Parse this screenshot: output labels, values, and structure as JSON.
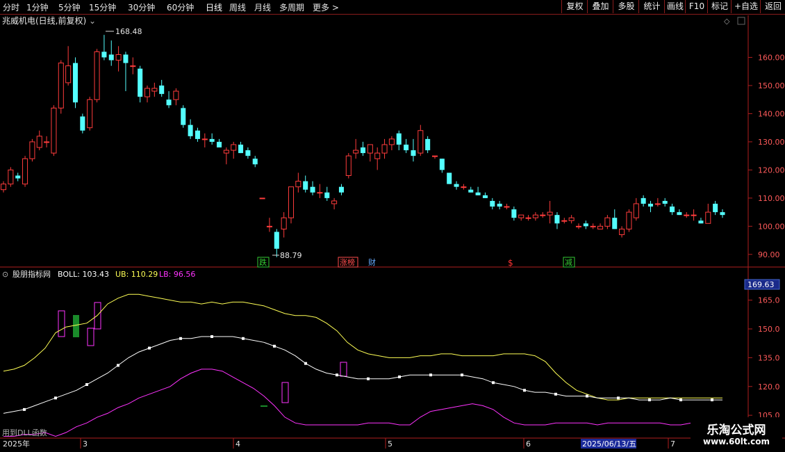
{
  "toolbar": {
    "timeframes": [
      "分时",
      "1分钟",
      "5分钟",
      "15分钟",
      "30分钟",
      "60分钟",
      "日线",
      "周线",
      "月线",
      "多周期",
      "更多 >"
    ],
    "active": "日线",
    "actions": [
      "复权",
      "叠加",
      "多股",
      "统计",
      "画线",
      "F10",
      "标记",
      "+自选",
      "返回"
    ]
  },
  "main_panel": {
    "title": "兆威机电(日线,前复权)",
    "high_label": "168.48",
    "low_label": "88.79",
    "event_markers": [
      {
        "text": "跌",
        "color": "#33cc33",
        "boxed": true
      },
      {
        "text": "涨榜",
        "color": "#ff4d4d",
        "boxed": true
      },
      {
        "text": "财",
        "color": "#66aaff",
        "boxed": false
      },
      {
        "text": "$",
        "color": "#ff3333",
        "boxed": false
      },
      {
        "text": "减",
        "color": "#33cc33",
        "boxed": true
      }
    ]
  },
  "indicator_panel": {
    "title": "股朋指标网",
    "boll_label": "BOLL: 103.43",
    "ub_label": "UB: 110.29",
    "lb_label": "LB: 96.56",
    "value_box": "169.63",
    "bottom_text": "用到DLL函数"
  },
  "date_axis": {
    "labels": [
      "2025年",
      "3",
      "4",
      "5",
      "6",
      "2025/06/13/五",
      "7"
    ]
  },
  "watermark": {
    "line1": "乐淘公式网",
    "line2": "www.60lt.com"
  },
  "colors": {
    "up": "#ff3c3c",
    "down": "#54ffff",
    "boll": "#ffffff",
    "ub": "#ffff55",
    "lb": "#ff33ff",
    "axis": "#b01e1e"
  },
  "chart_data": [
    {
      "type": "candlestick",
      "title": "兆威机电(日线,前复权)",
      "y_ticks": [
        90,
        100,
        110,
        120,
        130,
        140,
        150,
        160
      ],
      "ylim": [
        86,
        171
      ],
      "candles": [
        {
          "o": 113,
          "h": 116,
          "l": 112,
          "c": 115
        },
        {
          "o": 115,
          "h": 121,
          "l": 114,
          "c": 120
        },
        {
          "o": 118,
          "h": 119,
          "l": 116,
          "c": 117
        },
        {
          "o": 115,
          "h": 125,
          "l": 114,
          "c": 124
        },
        {
          "o": 124,
          "h": 131,
          "l": 123,
          "c": 130
        },
        {
          "o": 128,
          "h": 134,
          "l": 127,
          "c": 132
        },
        {
          "o": 130,
          "h": 132,
          "l": 128,
          "c": 130
        },
        {
          "o": 126,
          "h": 143,
          "l": 125,
          "c": 142
        },
        {
          "o": 142,
          "h": 159,
          "l": 140,
          "c": 158
        },
        {
          "o": 151,
          "h": 164,
          "l": 150,
          "c": 157
        },
        {
          "o": 158,
          "h": 160,
          "l": 142,
          "c": 144
        },
        {
          "o": 139,
          "h": 140,
          "l": 133,
          "c": 134
        },
        {
          "o": 135,
          "h": 146,
          "l": 134,
          "c": 145
        },
        {
          "o": 145,
          "h": 163,
          "l": 144,
          "c": 162
        },
        {
          "o": 162,
          "h": 168,
          "l": 159,
          "c": 160
        },
        {
          "o": 161,
          "h": 166,
          "l": 157,
          "c": 159
        },
        {
          "o": 159,
          "h": 164,
          "l": 155,
          "c": 161
        },
        {
          "o": 161,
          "h": 162,
          "l": 148,
          "c": 158
        },
        {
          "o": 157,
          "h": 160,
          "l": 154,
          "c": 157
        },
        {
          "o": 156,
          "h": 157,
          "l": 144,
          "c": 146
        },
        {
          "o": 146,
          "h": 150,
          "l": 144,
          "c": 149
        },
        {
          "o": 148,
          "h": 151,
          "l": 146,
          "c": 149
        },
        {
          "o": 150,
          "h": 152,
          "l": 146,
          "c": 147
        },
        {
          "o": 145,
          "h": 148,
          "l": 142,
          "c": 143
        },
        {
          "o": 145,
          "h": 149,
          "l": 143,
          "c": 148
        },
        {
          "o": 142,
          "h": 143,
          "l": 135,
          "c": 136
        },
        {
          "o": 136,
          "h": 138,
          "l": 131,
          "c": 132
        },
        {
          "o": 134,
          "h": 135,
          "l": 130,
          "c": 131
        },
        {
          "o": 131,
          "h": 133,
          "l": 128,
          "c": 131
        },
        {
          "o": 131,
          "h": 133,
          "l": 129,
          "c": 130
        },
        {
          "o": 130,
          "h": 131,
          "l": 128,
          "c": 128
        },
        {
          "o": 126,
          "h": 128,
          "l": 122,
          "c": 127
        },
        {
          "o": 127,
          "h": 130,
          "l": 124,
          "c": 129
        },
        {
          "o": 129,
          "h": 130,
          "l": 126,
          "c": 126
        },
        {
          "o": 127,
          "h": 128,
          "l": 124,
          "c": 125
        },
        {
          "o": 124,
          "h": 125,
          "l": 121,
          "c": 122
        },
        {
          "o": 110,
          "h": 110,
          "l": 110,
          "c": 110
        },
        {
          "o": 100,
          "h": 103,
          "l": 98,
          "c": 100
        },
        {
          "o": 98,
          "h": 99,
          "l": 89,
          "c": 92
        },
        {
          "o": 99,
          "h": 105,
          "l": 96,
          "c": 103
        },
        {
          "o": 103,
          "h": 114,
          "l": 101,
          "c": 114
        },
        {
          "o": 114,
          "h": 119,
          "l": 112,
          "c": 116
        },
        {
          "o": 116,
          "h": 118,
          "l": 112,
          "c": 113
        },
        {
          "o": 114,
          "h": 116,
          "l": 111,
          "c": 112
        },
        {
          "o": 112,
          "h": 115,
          "l": 110,
          "c": 112
        },
        {
          "o": 112,
          "h": 114,
          "l": 109,
          "c": 110
        },
        {
          "o": 108,
          "h": 110,
          "l": 106,
          "c": 109
        },
        {
          "o": 114,
          "h": 115,
          "l": 111,
          "c": 112
        },
        {
          "o": 118,
          "h": 126,
          "l": 117,
          "c": 125
        },
        {
          "o": 126,
          "h": 131,
          "l": 124,
          "c": 127
        },
        {
          "o": 128,
          "h": 130,
          "l": 125,
          "c": 126
        },
        {
          "o": 126,
          "h": 129,
          "l": 123,
          "c": 129
        },
        {
          "o": 124,
          "h": 128,
          "l": 120,
          "c": 126
        },
        {
          "o": 126,
          "h": 131,
          "l": 124,
          "c": 129
        },
        {
          "o": 129,
          "h": 132,
          "l": 127,
          "c": 131
        },
        {
          "o": 133,
          "h": 134,
          "l": 127,
          "c": 129
        },
        {
          "o": 129,
          "h": 131,
          "l": 126,
          "c": 127
        },
        {
          "o": 127,
          "h": 131,
          "l": 123,
          "c": 125
        },
        {
          "o": 126,
          "h": 136,
          "l": 125,
          "c": 134
        },
        {
          "o": 131,
          "h": 132,
          "l": 126,
          "c": 127
        },
        {
          "o": 125,
          "h": 125,
          "l": 124,
          "c": 125
        },
        {
          "o": 124,
          "h": 124,
          "l": 119,
          "c": 120
        },
        {
          "o": 119,
          "h": 119,
          "l": 115,
          "c": 115
        },
        {
          "o": 115,
          "h": 116,
          "l": 113,
          "c": 114
        },
        {
          "o": 114,
          "h": 115,
          "l": 113,
          "c": 114
        },
        {
          "o": 113,
          "h": 114,
          "l": 112,
          "c": 112
        },
        {
          "o": 112,
          "h": 114,
          "l": 111,
          "c": 111
        },
        {
          "o": 111,
          "h": 112,
          "l": 110,
          "c": 110
        },
        {
          "o": 109,
          "h": 110,
          "l": 106,
          "c": 107
        },
        {
          "o": 108,
          "h": 109,
          "l": 106,
          "c": 107
        },
        {
          "o": 107,
          "h": 108,
          "l": 106,
          "c": 107
        },
        {
          "o": 106,
          "h": 107,
          "l": 102,
          "c": 103
        },
        {
          "o": 103,
          "h": 104,
          "l": 102,
          "c": 104
        },
        {
          "o": 103,
          "h": 104,
          "l": 102,
          "c": 103
        },
        {
          "o": 103,
          "h": 105,
          "l": 102,
          "c": 104
        },
        {
          "o": 104,
          "h": 105,
          "l": 103,
          "c": 104
        },
        {
          "o": 104,
          "h": 109,
          "l": 101,
          "c": 105
        },
        {
          "o": 104,
          "h": 105,
          "l": 99,
          "c": 101
        },
        {
          "o": 102,
          "h": 103,
          "l": 101,
          "c": 102
        },
        {
          "o": 102,
          "h": 104,
          "l": 101,
          "c": 103
        },
        {
          "o": 100,
          "h": 101,
          "l": 99,
          "c": 100
        },
        {
          "o": 101,
          "h": 102,
          "l": 99,
          "c": 100
        },
        {
          "o": 100,
          "h": 101,
          "l": 99,
          "c": 100
        },
        {
          "o": 99,
          "h": 101,
          "l": 99,
          "c": 100
        },
        {
          "o": 100,
          "h": 104,
          "l": 99,
          "c": 103
        },
        {
          "o": 103,
          "h": 106,
          "l": 99,
          "c": 99
        },
        {
          "o": 97,
          "h": 100,
          "l": 96,
          "c": 99
        },
        {
          "o": 99,
          "h": 106,
          "l": 98,
          "c": 105
        },
        {
          "o": 103,
          "h": 110,
          "l": 102,
          "c": 108
        },
        {
          "o": 110,
          "h": 111,
          "l": 107,
          "c": 108
        },
        {
          "o": 108,
          "h": 109,
          "l": 105,
          "c": 107
        },
        {
          "o": 108,
          "h": 110,
          "l": 107,
          "c": 108
        },
        {
          "o": 109,
          "h": 110,
          "l": 107,
          "c": 108
        },
        {
          "o": 107,
          "h": 108,
          "l": 104,
          "c": 105
        },
        {
          "o": 105,
          "h": 106,
          "l": 104,
          "c": 104
        },
        {
          "o": 104,
          "h": 105,
          "l": 103,
          "c": 104
        },
        {
          "o": 104,
          "h": 106,
          "l": 102,
          "c": 104
        },
        {
          "o": 102,
          "h": 103,
          "l": 101,
          "c": 101
        },
        {
          "o": 101,
          "h": 108,
          "l": 101,
          "c": 105
        },
        {
          "o": 108,
          "h": 109,
          "l": 104,
          "c": 105
        },
        {
          "o": 105,
          "h": 106,
          "l": 103,
          "c": 104
        }
      ]
    },
    {
      "type": "line",
      "title": "股朋指标网",
      "y_ticks": [
        105,
        120,
        135,
        150,
        165
      ],
      "ylim": [
        96,
        175
      ],
      "series": [
        {
          "name": "UB",
          "color": "#ffff55",
          "values": [
            128,
            129,
            131,
            135,
            140,
            148,
            151,
            152,
            153,
            157,
            163,
            166,
            168,
            168,
            167,
            166,
            165,
            164,
            164,
            163,
            164,
            163,
            164,
            164,
            163,
            162,
            160,
            158,
            157,
            157,
            156,
            153,
            149,
            143,
            139,
            137,
            136,
            135,
            135,
            135,
            136,
            136,
            137,
            137,
            136,
            136,
            136,
            136,
            137,
            137,
            137,
            136,
            133,
            127,
            122,
            118,
            116,
            114,
            113,
            113,
            114,
            114,
            114,
            114,
            114,
            114,
            114,
            114,
            114,
            114
          ]
        },
        {
          "name": "BOLL",
          "color": "#ffffff",
          "values": [
            106,
            107,
            108,
            110,
            112,
            114,
            116,
            118,
            121,
            124,
            127,
            131,
            135,
            138,
            140,
            142,
            144,
            145,
            145,
            146,
            146,
            146,
            146,
            145,
            144,
            143,
            141,
            139,
            136,
            132,
            129,
            127,
            126,
            125,
            124,
            124,
            124,
            124,
            125,
            126,
            126,
            126,
            126,
            126,
            126,
            125,
            124,
            122,
            121,
            120,
            118,
            117,
            117,
            116,
            115,
            115,
            115,
            114,
            114,
            114,
            114,
            113,
            113,
            113,
            114,
            113,
            113,
            113,
            113,
            113
          ]
        },
        {
          "name": "LB",
          "color": "#ff33ff",
          "values": [
            94,
            94,
            95,
            95,
            96,
            94,
            96,
            99,
            101,
            104,
            106,
            109,
            111,
            114,
            116,
            118,
            120,
            124,
            127,
            129,
            129,
            128,
            125,
            122,
            119,
            115,
            110,
            104,
            101,
            100,
            100,
            100,
            100,
            100,
            100,
            101,
            101,
            101,
            100,
            100,
            104,
            107,
            108,
            109,
            110,
            111,
            110,
            108,
            104,
            101,
            100,
            100,
            100,
            101,
            101,
            101,
            101,
            100,
            101,
            101,
            101,
            101,
            101,
            101,
            100,
            100,
            101,
            101,
            101,
            101
          ]
        }
      ]
    }
  ]
}
